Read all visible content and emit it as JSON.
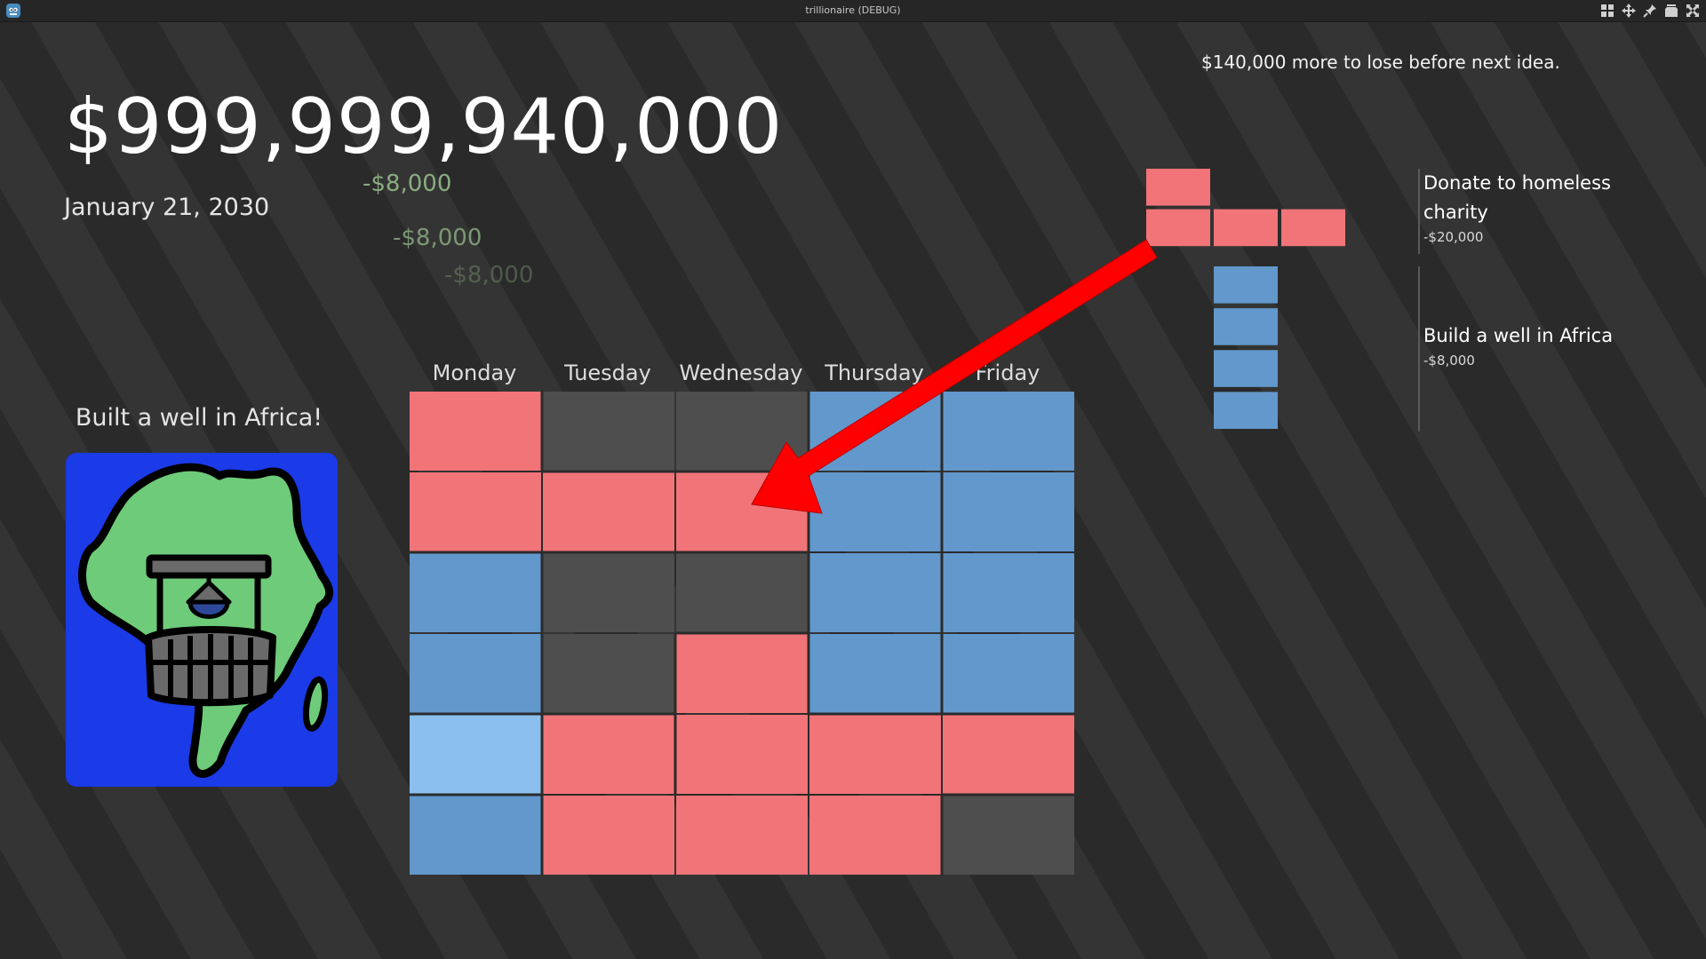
{
  "window": {
    "title": "trillionaire (DEBUG)"
  },
  "hud": {
    "budget": "$999,999,940,000",
    "date": "January 21, 2030",
    "status": "$140,000 more to lose before next idea.",
    "floating_losses": [
      "-$8,000",
      "-$8,000",
      "-$8,000"
    ]
  },
  "result": {
    "caption": "Built a well in Africa!"
  },
  "schedule": {
    "days": [
      "Monday",
      "Tuesday",
      "Wednesday",
      "Thursday",
      "Friday"
    ],
    "rows": 6,
    "colors": {
      "empty": "#4e4e4e",
      "red": "#f07478",
      "blue": "#6298cc",
      "blue_highlight": "#8bbfee",
      "grid_line": "#2b2b2b"
    },
    "cells": [
      [
        "red",
        "empty",
        "empty",
        "blue",
        "blue"
      ],
      [
        "red",
        "red",
        "red",
        "blue",
        "blue"
      ],
      [
        "blue",
        "empty",
        "empty",
        "blue",
        "blue"
      ],
      [
        "blue",
        "empty",
        "red",
        "blue",
        "blue"
      ],
      [
        "blue_highlight",
        "red",
        "red",
        "red",
        "red"
      ],
      [
        "blue",
        "red",
        "red",
        "red",
        "empty"
      ]
    ]
  },
  "options": [
    {
      "name": "Donate to homeless charity",
      "cost": "-$20,000",
      "color": "#f07478",
      "shape": [
        [
          0,
          0
        ],
        [
          0,
          1
        ],
        [
          1,
          1
        ],
        [
          2,
          1
        ]
      ]
    },
    {
      "name": "Build a well in Africa",
      "cost": "-$8,000",
      "color": "#6298cc",
      "shape": [
        [
          1,
          2
        ],
        [
          1,
          3
        ],
        [
          1,
          4
        ],
        [
          1,
          5
        ]
      ]
    }
  ],
  "icons": {
    "app": "godot-icon",
    "arrow": "red-arrow-icon",
    "art": "africa-well-icon"
  }
}
